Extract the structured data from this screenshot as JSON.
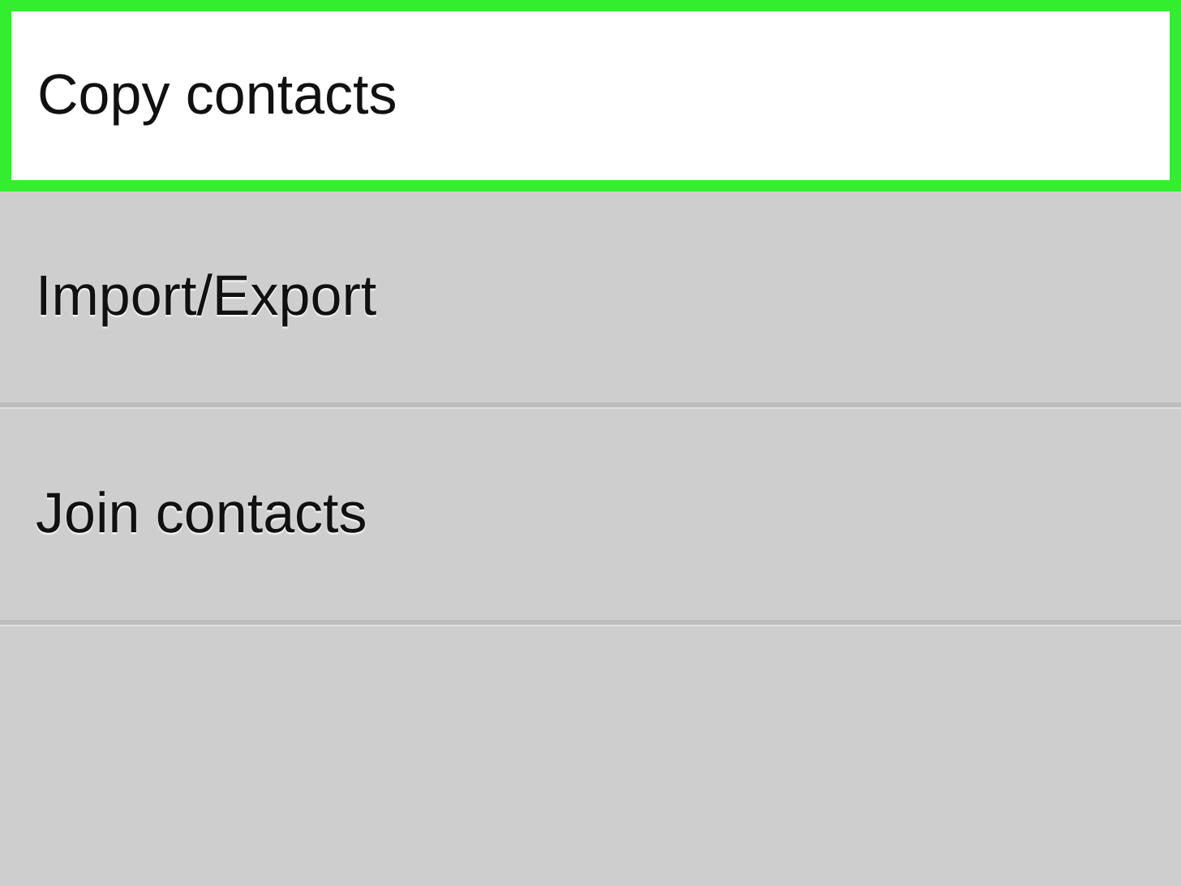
{
  "menu": {
    "items": [
      {
        "label": "Copy contacts",
        "selected": true
      },
      {
        "label": "Import/Export",
        "selected": false
      },
      {
        "label": "Join contacts",
        "selected": false
      }
    ]
  }
}
